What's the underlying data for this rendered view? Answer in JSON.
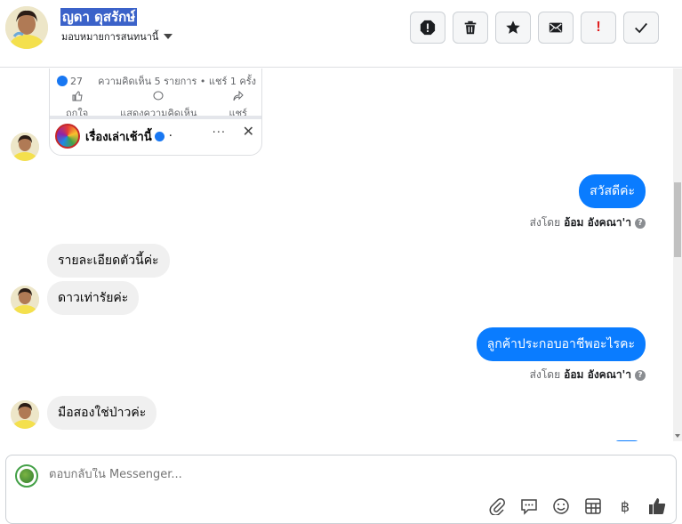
{
  "header": {
    "name": "ญดา ดุสรักษ์",
    "assignment": "มอบหมายการสนทนานี้",
    "actions": [
      {
        "icon": "alert-circle-icon",
        "label": "Mark as spam"
      },
      {
        "icon": "trash-icon",
        "label": "Delete"
      },
      {
        "icon": "star-icon",
        "label": "Star"
      },
      {
        "icon": "envelope-icon",
        "label": "Mark unread"
      },
      {
        "icon": "exclamation-icon",
        "label": "Follow up"
      },
      {
        "icon": "check-icon",
        "label": "Done"
      }
    ]
  },
  "shared_post": {
    "reactions": "27",
    "stats": "ความคิดเห็น 5 รายการ • แชร์ 1 ครั้ง",
    "like_label": "ถูกใจ",
    "comment_label": "แสดงความคิดเห็น",
    "share_label": "แชร์",
    "page_name": "เรื่องเล่าเช้านี้",
    "dot": "·",
    "more": "···",
    "close": "✕"
  },
  "messages": [
    {
      "direction": "out",
      "text": "สวัสดีค่ะ"
    },
    {
      "direction": "in",
      "text": "รายละเอียดตัวนี้ค่ะ"
    },
    {
      "direction": "in",
      "text": "ดาวเท่ารัยค่ะ"
    },
    {
      "direction": "out",
      "text": "ลูกค้าประกอบอาชีพอะไรคะ"
    },
    {
      "direction": "in",
      "text": "มือสองใช่ป่าวค่ะ"
    }
  ],
  "sent_by": {
    "prefix": "ส่งโดย",
    "agent": "อ้อม อังคณา'า",
    "help": "?"
  },
  "composer": {
    "placeholder": "ตอบกลับใน Messenger...",
    "tools": [
      "paperclip-icon",
      "chat-bubble-icon",
      "emoji-icon",
      "table-icon",
      "baht-icon",
      "thumbs-up-icon"
    ],
    "baht_symbol": "฿"
  },
  "colors": {
    "accent": "#0a7cff",
    "incoming_bubble": "#f0f0f0",
    "name_highlight": "#3b62c9"
  }
}
